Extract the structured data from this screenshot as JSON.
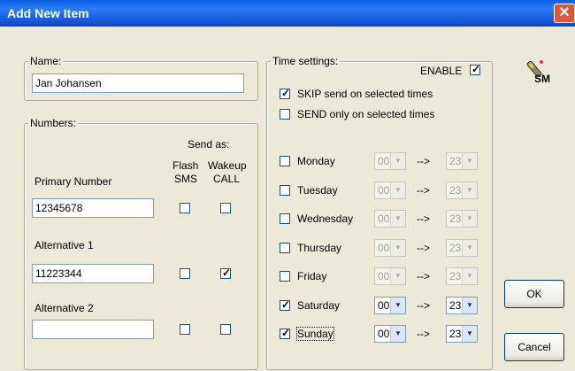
{
  "window": {
    "title": "Add New Item",
    "close_symbol": "✕"
  },
  "name_group": {
    "legend": "Name:",
    "value": "Jan Johansen"
  },
  "numbers_group": {
    "legend": "Numbers:",
    "send_as_label": "Send as:",
    "flash_label_1": "Flash",
    "flash_label_2": "SMS",
    "wakeup_label_1": "Wakeup",
    "wakeup_label_2": "CALL",
    "primary": {
      "label": "Primary Number",
      "value": "12345678",
      "flash": false,
      "wakeup": false
    },
    "alt1": {
      "label": "Alternative 1",
      "value": "11223344",
      "flash": false,
      "wakeup": true
    },
    "alt2": {
      "label": "Alternative 2",
      "value": "",
      "flash": false,
      "wakeup": false
    }
  },
  "time_group": {
    "legend": "Time settings:",
    "enable_label": "ENABLE",
    "enable_checked": true,
    "skip_label": "SKIP send on selected times",
    "skip_checked": true,
    "send_only_label": "SEND only on selected times",
    "send_only_checked": false,
    "arrow_text": "-->",
    "days": [
      {
        "label": "Monday",
        "checked": false,
        "from": "00",
        "to": "23",
        "enabled": false
      },
      {
        "label": "Tuesday",
        "checked": false,
        "from": "00",
        "to": "23",
        "enabled": false
      },
      {
        "label": "Wednesday",
        "checked": false,
        "from": "00",
        "to": "23",
        "enabled": false
      },
      {
        "label": "Thursday",
        "checked": false,
        "from": "00",
        "to": "23",
        "enabled": false
      },
      {
        "label": "Friday",
        "checked": false,
        "from": "00",
        "to": "23",
        "enabled": false
      },
      {
        "label": "Saturday",
        "checked": true,
        "from": "00",
        "to": "23",
        "enabled": true
      },
      {
        "label": "Sunday",
        "checked": true,
        "from": "00",
        "to": "23",
        "enabled": true
      }
    ]
  },
  "logo": {
    "text": "SM",
    "icon": "wrench-pen-icon"
  },
  "buttons": {
    "ok": "OK",
    "cancel": "Cancel"
  },
  "colors": {
    "title_bar": "#0a5fe0",
    "close_button": "#e05535",
    "dialog_bg": "#ece9d8"
  }
}
